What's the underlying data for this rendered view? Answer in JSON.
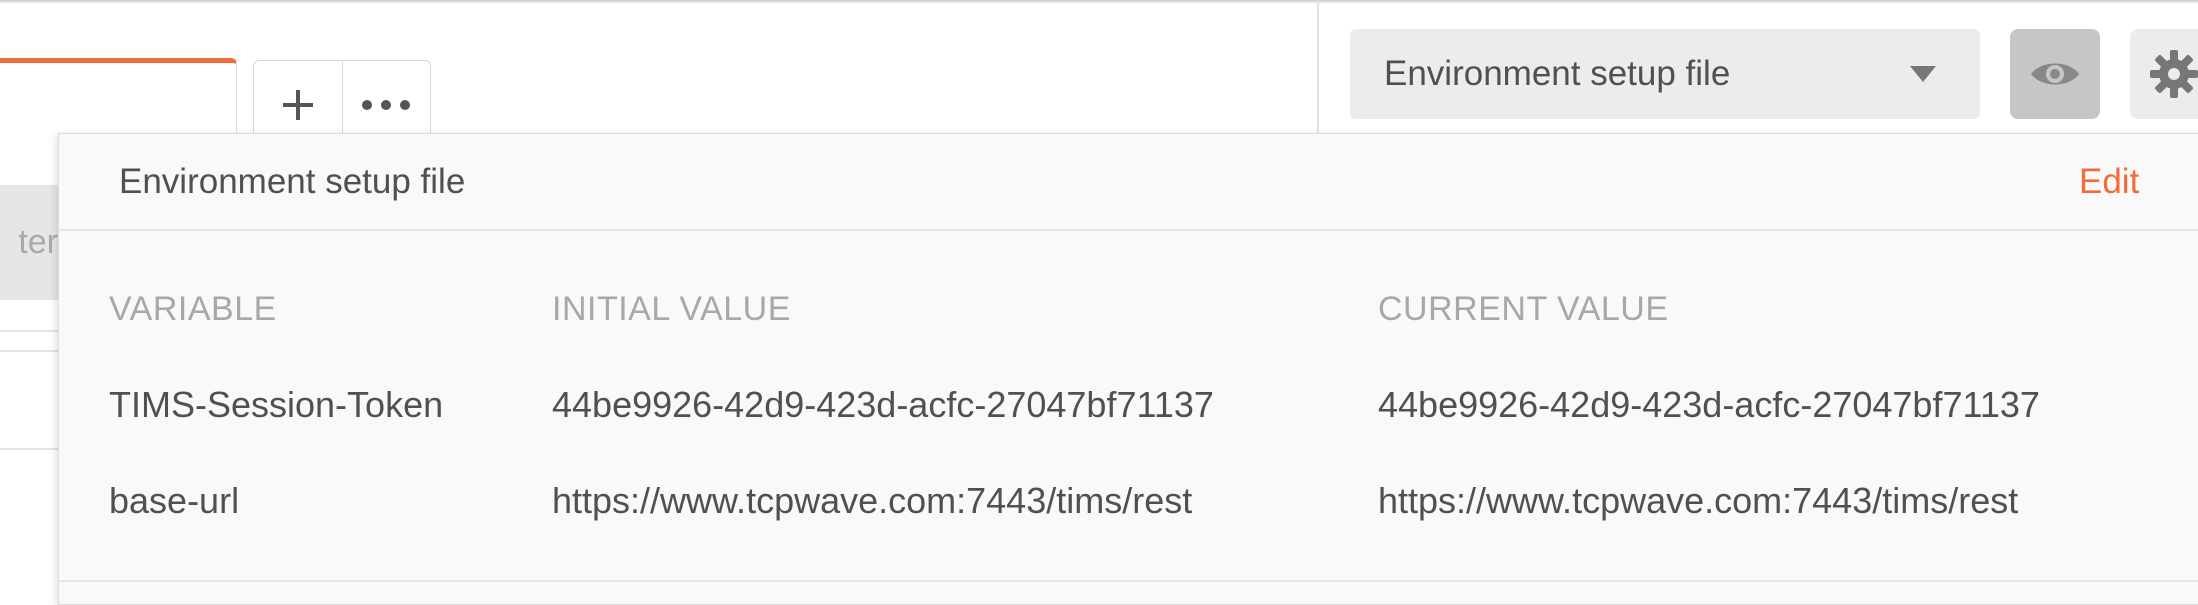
{
  "environment": {
    "selected": "Environment setup file"
  },
  "left_fragment": {
    "filter_text": "ter"
  },
  "popup": {
    "title": "Environment setup file",
    "edit_label": "Edit",
    "columns": [
      "VARIABLE",
      "INITIAL VALUE",
      "CURRENT VALUE"
    ],
    "rows": [
      {
        "variable": "TIMS-Session-Token",
        "initial_value": "44be9926-42d9-423d-acfc-27047bf71137",
        "current_value": "44be9926-42d9-423d-acfc-27047bf71137"
      },
      {
        "variable": "base-url",
        "initial_value": "https://www.tcpwave.com:7443/tims/rest",
        "current_value": "https://www.tcpwave.com:7443/tims/rest"
      }
    ]
  },
  "icons": {
    "add": "plus-icon",
    "more": "more-horizontal-icon",
    "dropdown": "chevron-down-icon",
    "quick_look": "eye-icon",
    "settings": "gear-icon"
  },
  "colors": {
    "accent": "#f26b3a",
    "eye_button_bg": "#c6c6c6",
    "select_bg": "#ececec",
    "header_text": "#a8a8a8"
  }
}
